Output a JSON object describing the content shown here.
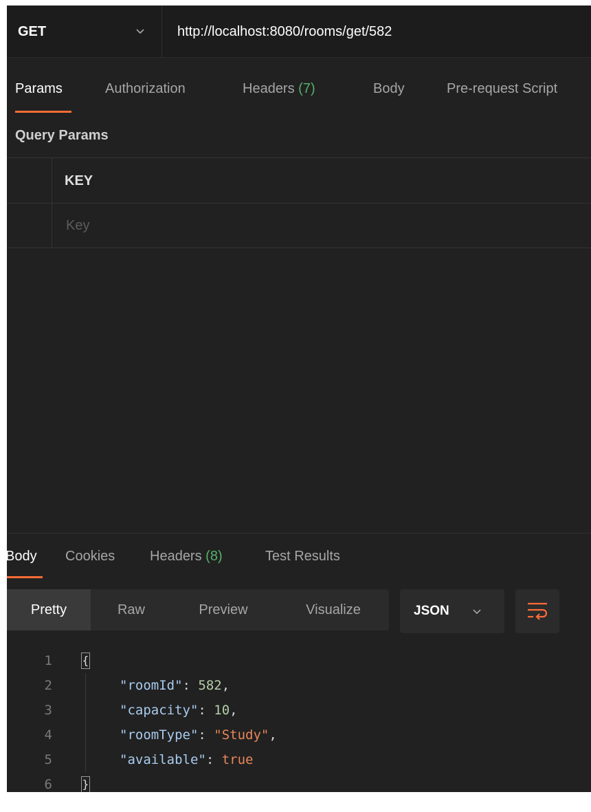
{
  "request": {
    "method": "GET",
    "url": "http://localhost:8080/rooms/get/582"
  },
  "request_tabs": [
    {
      "label": "Params",
      "count": ""
    },
    {
      "label": "Authorization",
      "count": ""
    },
    {
      "label": "Headers",
      "count": "(7)"
    },
    {
      "label": "Body",
      "count": ""
    },
    {
      "label": "Pre-request Script",
      "count": ""
    }
  ],
  "params": {
    "section_title": "Query Params",
    "key_header": "KEY",
    "key_placeholder": "Key"
  },
  "response_tabs": [
    {
      "label": "Body",
      "count": ""
    },
    {
      "label": "Cookies",
      "count": ""
    },
    {
      "label": "Headers",
      "count": "(8)"
    },
    {
      "label": "Test Results",
      "count": ""
    }
  ],
  "view_modes": [
    "Pretty",
    "Raw",
    "Preview",
    "Visualize"
  ],
  "format": "JSON",
  "response_body": {
    "line_numbers": [
      "1",
      "2",
      "3",
      "4",
      "5",
      "6"
    ],
    "open_brace": "{",
    "close_brace": "}",
    "fields": [
      {
        "key": "\"roomId\"",
        "value": "582",
        "kind": "num",
        "sep": ","
      },
      {
        "key": "\"capacity\"",
        "value": "10",
        "kind": "num",
        "sep": ","
      },
      {
        "key": "\"roomType\"",
        "value": "\"Study\"",
        "kind": "str",
        "sep": ","
      },
      {
        "key": "\"available\"",
        "value": "true",
        "kind": "bool",
        "sep": ""
      }
    ]
  },
  "colors": {
    "accent": "#ff6c37",
    "count": "#57b06a",
    "background": "#212121"
  }
}
